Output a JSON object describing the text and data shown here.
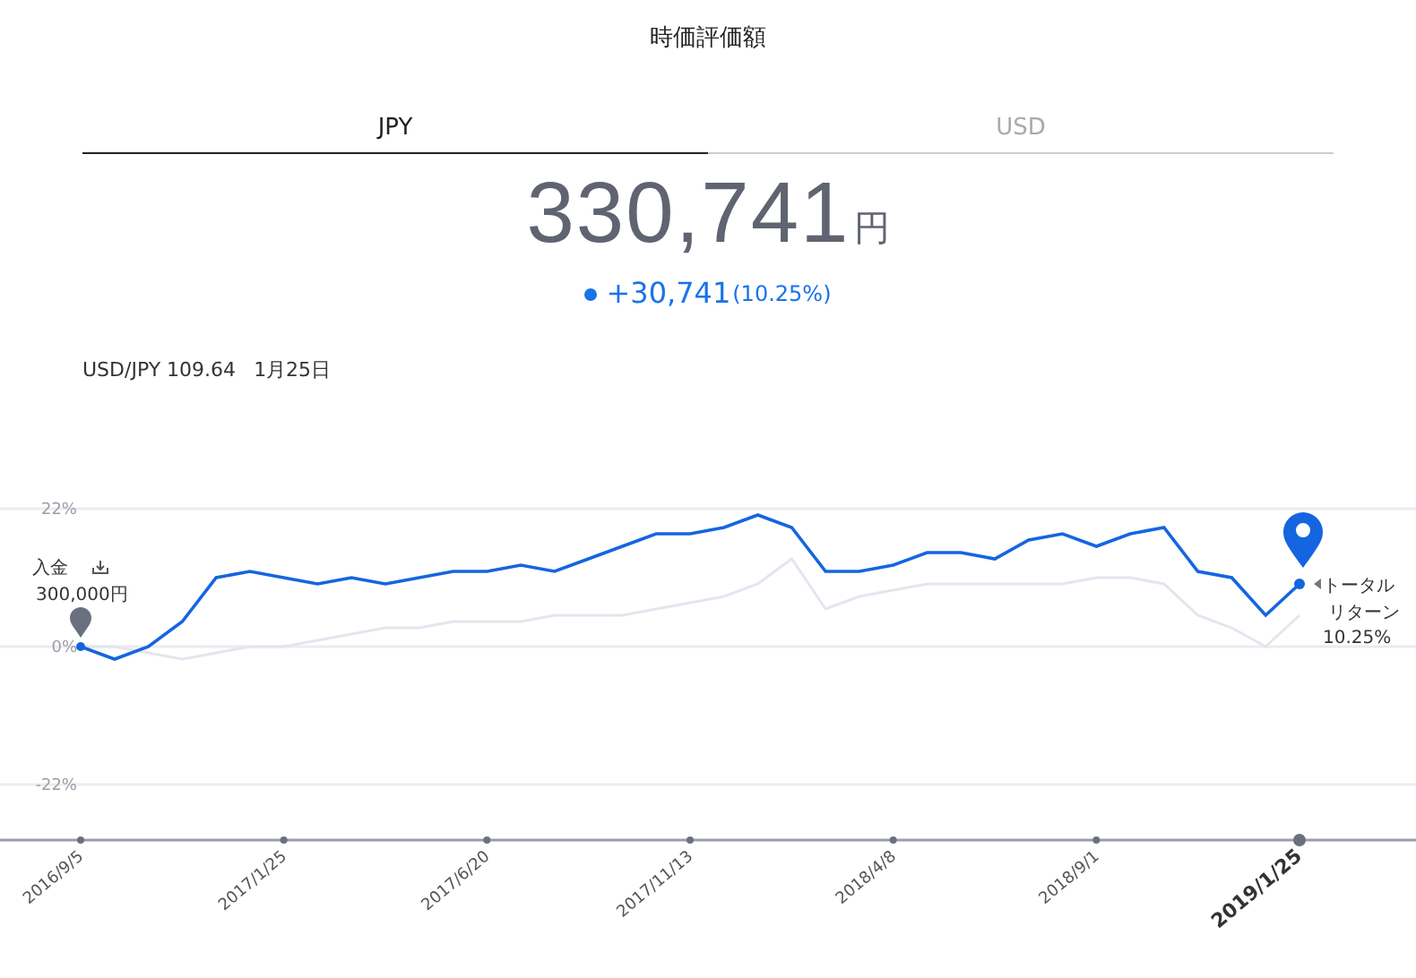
{
  "title": "時価評価額",
  "tabs": [
    {
      "label": "JPY",
      "selected": true
    },
    {
      "label": "USD",
      "selected": false
    }
  ],
  "value": {
    "amount": "330,741",
    "unit": "円",
    "change": "+30,741",
    "change_pct": "(10.25%)",
    "color": "#1a73e8"
  },
  "rate": {
    "pair": "USD/JPY 109.64",
    "date": "1月25日"
  },
  "chart": {
    "chart_data": {
      "type": "line",
      "categories": [
        "2016/9/5",
        null,
        null,
        null,
        null,
        null,
        "2017/1/25",
        null,
        null,
        null,
        null,
        null,
        "2017/6/20",
        null,
        null,
        null,
        null,
        null,
        "2017/11/13",
        null,
        null,
        null,
        null,
        null,
        "2018/4/8",
        null,
        null,
        null,
        null,
        null,
        "2018/9/1",
        null,
        null,
        null,
        null,
        null,
        "2019/1/25"
      ],
      "series": [
        {
          "color": "#1565e0",
          "values": [
            0,
            -2,
            0,
            4,
            11,
            12,
            11,
            10,
            11,
            10,
            11,
            12,
            12,
            13,
            12,
            14,
            16,
            18,
            18,
            19,
            21,
            19,
            12,
            12,
            13,
            15,
            15,
            14,
            17,
            18,
            16,
            18,
            19,
            12,
            11,
            5,
            10
          ]
        },
        {
          "color": "#e3e6ee",
          "values": [
            0,
            0,
            -1,
            -2,
            -1,
            0,
            0,
            1,
            2,
            3,
            3,
            4,
            4,
            4,
            5,
            5,
            5,
            6,
            7,
            8,
            10,
            14,
            6,
            8,
            9,
            10,
            10,
            10,
            10,
            10,
            11,
            11,
            10,
            5,
            3,
            0,
            5
          ]
        }
      ],
      "grid": true,
      "ylim": [
        -22,
        22
      ],
      "yticks": [
        {
          "value": 22,
          "label": "22%"
        },
        {
          "value": 0,
          "label": "0%"
        },
        {
          "value": -22,
          "label": "-22%"
        }
      ]
    },
    "annotations": [
      {
        "kind": "deposit",
        "lines": [
          "入金",
          "300,000円"
        ]
      },
      {
        "kind": "total",
        "lines": [
          "トータル",
          "リターン",
          "10.25%"
        ]
      }
    ]
  }
}
